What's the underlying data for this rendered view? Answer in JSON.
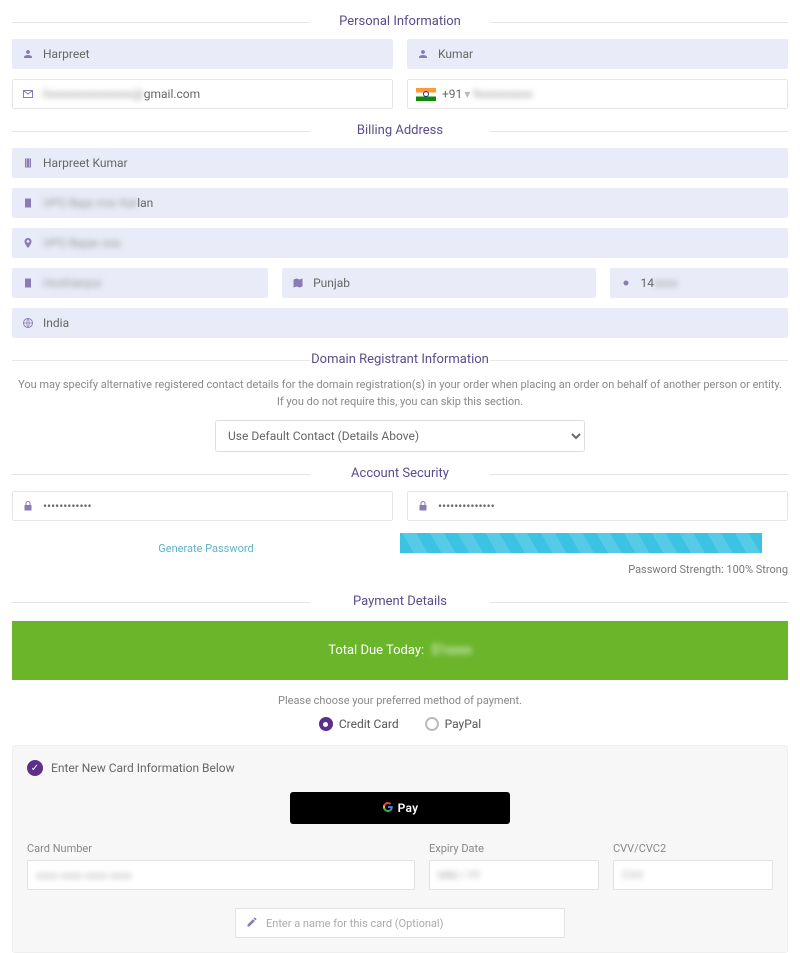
{
  "sections": {
    "personal": "Personal Information",
    "billing": "Billing Address",
    "domain": "Domain Registrant Information",
    "security": "Account Security",
    "payment": "Payment Details"
  },
  "personal": {
    "first_name": "Harpreet",
    "last_name": "Kumar",
    "email_suffix": "gmail.com",
    "phone_code": "+91",
    "phone_masked": "9xxxxxxxxx"
  },
  "billing": {
    "company": "Harpreet Kumar",
    "address1_visible": "lan",
    "state": "Punjab",
    "zip_prefix": "14",
    "country": "India"
  },
  "domain": {
    "helper": "You may specify alternative registered contact details for the domain registration(s) in your order when placing an order on behalf of another person or entity. If you do not require this, you can skip this section.",
    "select_label": "Use Default Contact (Details Above)"
  },
  "security": {
    "pw_mask1": "••••••••••••",
    "pw_mask2": "••••••••••••••",
    "gen_link": "Generate Password",
    "strength": "Password Strength: 100% Strong"
  },
  "payment": {
    "total_label": "Total Due Today:",
    "total_amount": "$1xxxx",
    "choose": "Please choose your preferred method of payment.",
    "opt_cc": "Credit Card",
    "opt_pp": "PayPal",
    "new_card": "Enter New Card Information Below",
    "gpay": "Pay",
    "cc_number_label": "Card Number",
    "cc_number_ph": "xxxx xxxx xxxx xxxx",
    "cc_expiry_label": "Expiry Date",
    "cc_expiry_ph": "MM / YY",
    "cc_cvv_label": "CVV/CVC2",
    "cc_cvv_ph": "CVV",
    "card_name_ph": "Enter a name for this card (Optional)"
  }
}
